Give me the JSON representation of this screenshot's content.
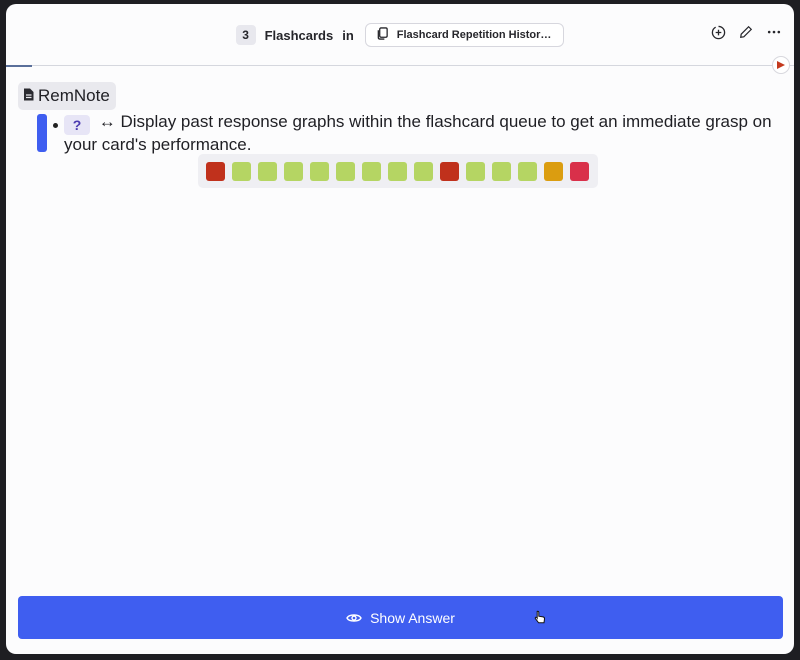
{
  "header": {
    "count": "3",
    "title": "Flashcards",
    "in_label": "in",
    "deck_name": "Flashcard Repetition Histor…"
  },
  "icons": {
    "deck": "cards-icon",
    "add": "plus-circle-icon",
    "edit": "pencil-icon",
    "more": "more-horizontal-icon",
    "flag": "red-flag-icon",
    "doc": "document-icon",
    "eye": "eye-icon"
  },
  "card": {
    "document_label": "RemNote",
    "question_marker": "?",
    "arrow": "↔",
    "text": "Display past response graphs within the flashcard queue to get an immediate grasp on your card's performance."
  },
  "history": [
    {
      "result": "forgot",
      "color": "#c0311c"
    },
    {
      "result": "good",
      "color": "#b5d563"
    },
    {
      "result": "good",
      "color": "#b5d563"
    },
    {
      "result": "good",
      "color": "#b5d563"
    },
    {
      "result": "good",
      "color": "#b5d563"
    },
    {
      "result": "good",
      "color": "#b5d563"
    },
    {
      "result": "good",
      "color": "#b5d563"
    },
    {
      "result": "good",
      "color": "#b5d563"
    },
    {
      "result": "good",
      "color": "#b5d563"
    },
    {
      "result": "forgot",
      "color": "#c0311c"
    },
    {
      "result": "good",
      "color": "#b5d563"
    },
    {
      "result": "good",
      "color": "#b5d563"
    },
    {
      "result": "good",
      "color": "#b5d563"
    },
    {
      "result": "hard",
      "color": "#db9d10"
    },
    {
      "result": "again",
      "color": "#d9304a"
    }
  ],
  "show_answer": {
    "label": "Show Answer"
  },
  "colors": {
    "accent": "#3f5ef0",
    "background": "#fcfcfd"
  }
}
